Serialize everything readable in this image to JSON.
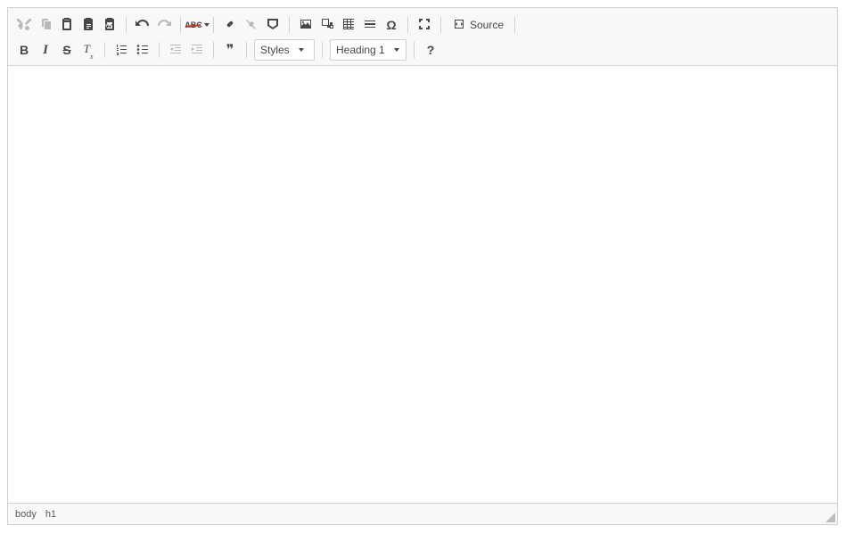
{
  "toolbar": {
    "row1": {
      "cut": "Cut",
      "copy": "Copy",
      "paste": "Paste",
      "paste_text": "Paste as plain text",
      "paste_word": "Paste from Word",
      "undo": "Undo",
      "redo": "Redo",
      "spellcheck": "Spell Check",
      "spellcheck_label": "ABC",
      "link": "Link",
      "unlink": "Unlink",
      "anchor": "Anchor",
      "image": "Image",
      "embed": "Embed Media",
      "table": "Table",
      "hr": "Insert Horizontal Line",
      "special_char": "Insert Special Character",
      "special_char_glyph": "Ω",
      "maximize": "Maximize",
      "source": "Source"
    },
    "row2": {
      "bold": "B",
      "italic": "I",
      "strike": "S",
      "remove_format": "Remove Format",
      "remove_format_glyph": "Tx",
      "ol": "Insert/Remove Numbered List",
      "ul": "Insert/Remove Bulleted List",
      "outdent": "Decrease Indent",
      "indent": "Increase Indent",
      "blockquote": "Block Quote",
      "blockquote_glyph": "❞",
      "styles_label": "Styles",
      "format_label": "Heading 1",
      "about": "About",
      "about_glyph": "?"
    }
  },
  "statusbar": {
    "path": [
      "body",
      "h1"
    ]
  }
}
